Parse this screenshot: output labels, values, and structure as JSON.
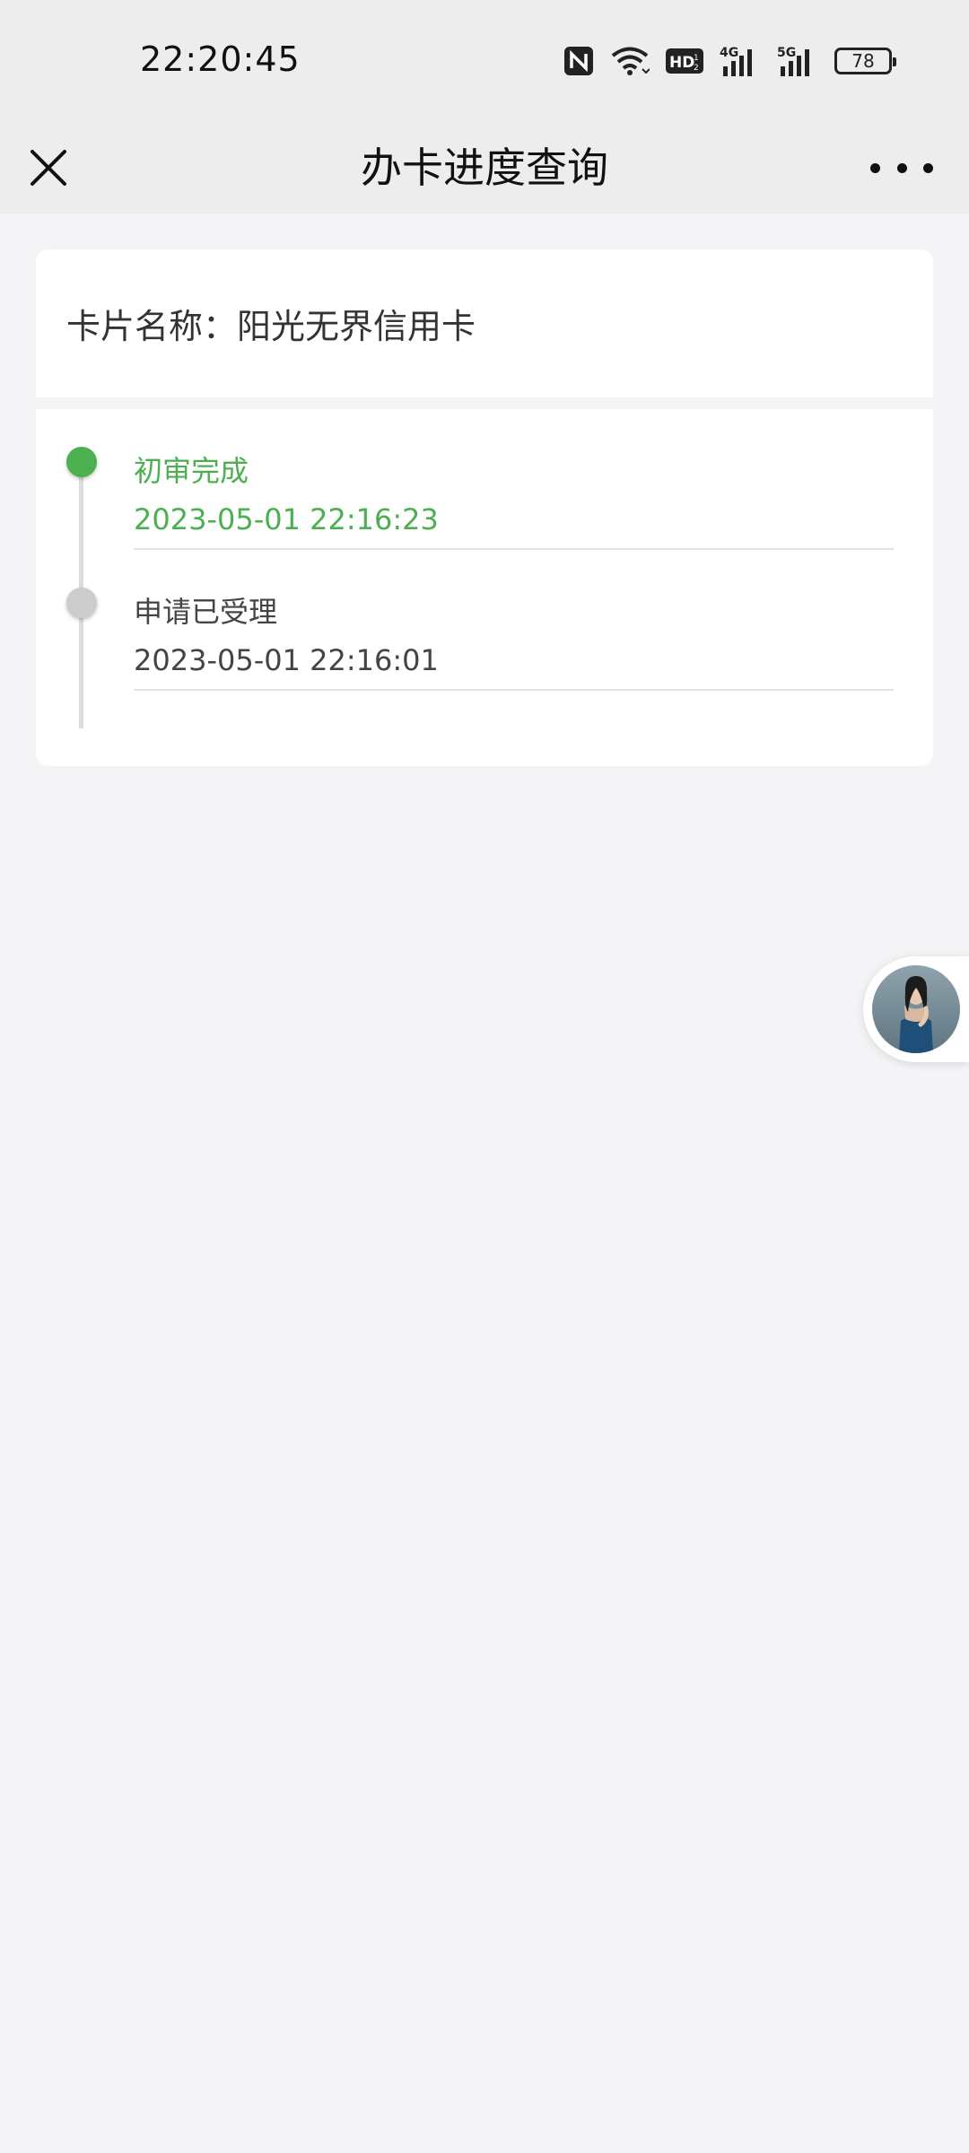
{
  "status_bar": {
    "time": "22:20:45",
    "icons": [
      "nfc-icon",
      "wifi-icon",
      "hd-icon",
      "4g-signal-icon",
      "5g-signal-icon"
    ],
    "battery": "78"
  },
  "nav": {
    "title": "办卡进度查询",
    "close_icon": "close-icon",
    "more_icon": "more-icon"
  },
  "card": {
    "name_label": "卡片名称：阳光无界信用卡"
  },
  "progress": {
    "steps": [
      {
        "title": "初审完成",
        "time": "2023-05-01 22:16:23",
        "status": "active"
      },
      {
        "title": "申请已受理",
        "time": "2023-05-01 22:16:01",
        "status": "done"
      }
    ]
  },
  "colors": {
    "active": "#4caf50",
    "inactive_dot": "#cccccc",
    "background": "#f4f4f6"
  }
}
